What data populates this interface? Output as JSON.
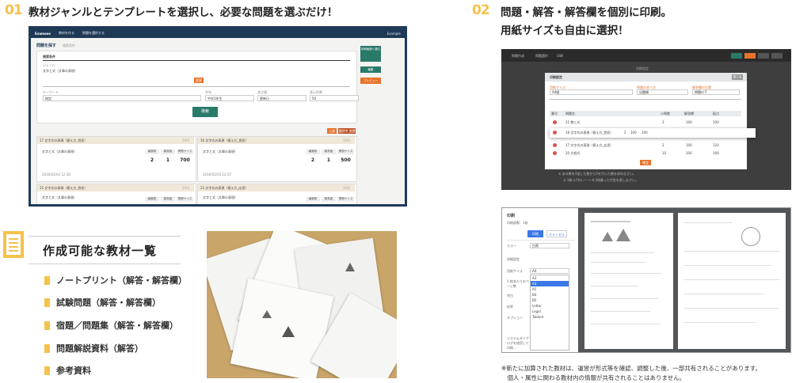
{
  "section1": {
    "number": "01",
    "heading": "教材ジャンルとテンプレートを選択し、必要な問題を選ぶだけ！",
    "screen": {
      "logo": "Examsee",
      "nav": [
        "教材を作る",
        "問題を選択する"
      ],
      "user": "Example",
      "page_title": "問題を探す",
      "page_sub": "検索条件",
      "search_label": "検索条件",
      "genre_label": "ジャンル",
      "genre_value": "文字と式（文章の表現）",
      "change_btn": "変更",
      "filters": [
        {
          "label": "キーワード",
          "value": "指定"
        },
        {
          "label": "学年",
          "value": "中学1年生"
        },
        {
          "label": "並び順",
          "value": "更新日"
        },
        {
          "label": "表示件数",
          "value": "50"
        }
      ],
      "search_btn": "検索",
      "side_buttons": [
        "印刷画面へ進む",
        "編集",
        "プレビュー"
      ],
      "list_buttons": [
        "上部",
        "選択中 並替"
      ],
      "cards": [
        {
          "title": "17 文字式の表現（値え方_覚初）",
          "tag": "16th",
          "body": "文字と式（文章の表現）",
          "cols": [
            "編集数",
            "難易度",
            "問題サイズ"
          ],
          "vals": [
            "2",
            "1",
            "700"
          ],
          "date": "2016/02/03 12:38"
        },
        {
          "title": "16 文字式の表現（値え方_覚初）",
          "tag": "16th",
          "body": "文字と式（文章の表現）",
          "cols": [
            "編集数",
            "難易度",
            "問題サイズ"
          ],
          "vals": [
            "2",
            "1",
            "500"
          ],
          "date": "2016/02/03 12:37"
        },
        {
          "title": "15 文字式の表現（値え方_覚初）",
          "tag": "16th",
          "body": "文字と式（文章の表現）",
          "cols": [
            "編集数",
            "難易度",
            "問題サイズ"
          ],
          "vals": [],
          "date": ""
        },
        {
          "title": "22 文字式の表現（値え方_応用）",
          "tag": "16th",
          "body": "文字と式（文章の表現）",
          "cols": [
            "編集数",
            "難易度",
            "問題サイズ"
          ],
          "vals": [],
          "date": ""
        }
      ]
    }
  },
  "section2": {
    "number": "02",
    "heading_line1": "問題・解答・解答欄を個別に印刷。",
    "heading_line2": "用紙サイズも自由に選択！",
    "screen_a": {
      "tabs": [
        "問題作成",
        "問題選択",
        "印刷"
      ],
      "header": "印刷設定",
      "dialog_title": "印刷設定",
      "close": "閉じる",
      "fields": [
        "用紙サイズ",
        "問題の並べ方",
        "解答欄の位置"
      ],
      "field_values": [
        "A4縦",
        "出題順",
        "問題の下"
      ],
      "table_cols": [
        "番号",
        "問題名",
        "小問数",
        "解答欄",
        "配点"
      ],
      "rows": [
        [
          "21 数と式",
          "3",
          "100",
          "100"
        ],
        [
          "18 文字式の表現（値え方_覚初）",
          "2",
          "100",
          "100"
        ],
        [
          "17 文字式の表現（値え方_応用）",
          "2",
          "100",
          "120"
        ],
        [
          "20 方程式",
          "10",
          "100",
          "100"
        ]
      ],
      "ok": "確定",
      "foot1": "① ある数を3倍した数から5を引いた数を求めなさい。",
      "foot2": "② 1冊 x 円のノートを3冊買った代金を表しなさい。"
    },
    "screen_b": {
      "panel_title": "印刷",
      "pages": "印刷部数：1枚",
      "print_btn": "印刷",
      "cancel_btn": "キャンセル",
      "color_label": "カラー",
      "color_value": "白黒",
      "paper_label": "用紙サイズ",
      "paper_value": "A4",
      "paper_options": [
        "A3",
        "A4",
        "A5",
        "B4",
        "B5",
        "Letter",
        "Legal",
        "Tabloid"
      ],
      "other_labels": [
        "1 枚あたりのページ数",
        "余白",
        "倍率",
        "オプション"
      ],
      "more": "システムダイアログを使用して印刷..."
    },
    "note_line1": "※新たに加算された教材は、運営が形式等を確認、調整した後、一部共有されることがあります。",
    "note_line2": "　個人・属性に関わる教材内の情報が共有されることはありません。"
  },
  "materials": {
    "title": "作成可能な教材一覧",
    "items": [
      "ノートプリント（解答・解答欄）",
      "試験問題（解答・解答欄）",
      "宿題／問題集（解答・解答欄）",
      "問題解説資料（解答）",
      "参考資料"
    ]
  },
  "colors": {
    "accent": "#f5c24b",
    "frame": "#1f3a57",
    "orange": "#e8732c",
    "teal": "#2a7a6a"
  }
}
